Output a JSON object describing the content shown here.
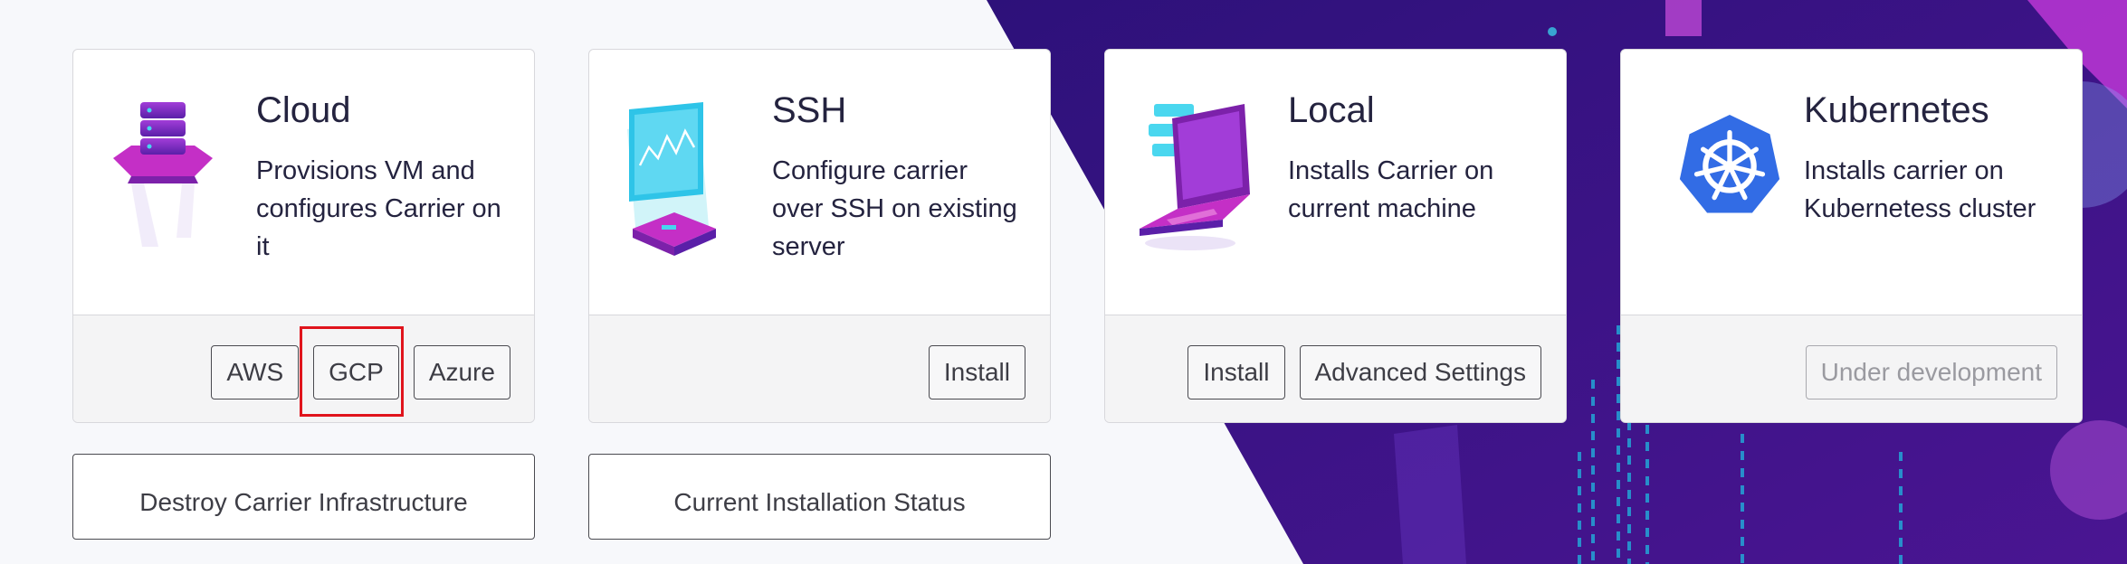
{
  "cards": [
    {
      "title": "Cloud",
      "description": "Provisions VM and configures Carrier on it",
      "icon": "cloud-server-icon",
      "buttons": [
        "AWS",
        "GCP",
        "Azure"
      ]
    },
    {
      "title": "SSH",
      "description": "Configure carrier over SSH on existing server",
      "icon": "ssh-terminal-icon",
      "buttons": [
        "Install"
      ]
    },
    {
      "title": "Local",
      "description": "Installs Carrier on current machine",
      "icon": "laptop-icon",
      "buttons": [
        "Install",
        "Advanced Settings"
      ]
    },
    {
      "title": "Kubernetes",
      "description": "Installs carrier on Kubernetess cluster",
      "icon": "kubernetes-icon",
      "buttons": [
        "Under development"
      ]
    }
  ],
  "actions": {
    "destroy_label": "Destroy Carrier Infrastructure",
    "status_label": "Current Installation Status"
  },
  "highlighted_button": "GCP",
  "colors": {
    "highlight": "#e0141c",
    "background_accent": "#3a1582",
    "kubernetes_blue": "#326ce5"
  }
}
